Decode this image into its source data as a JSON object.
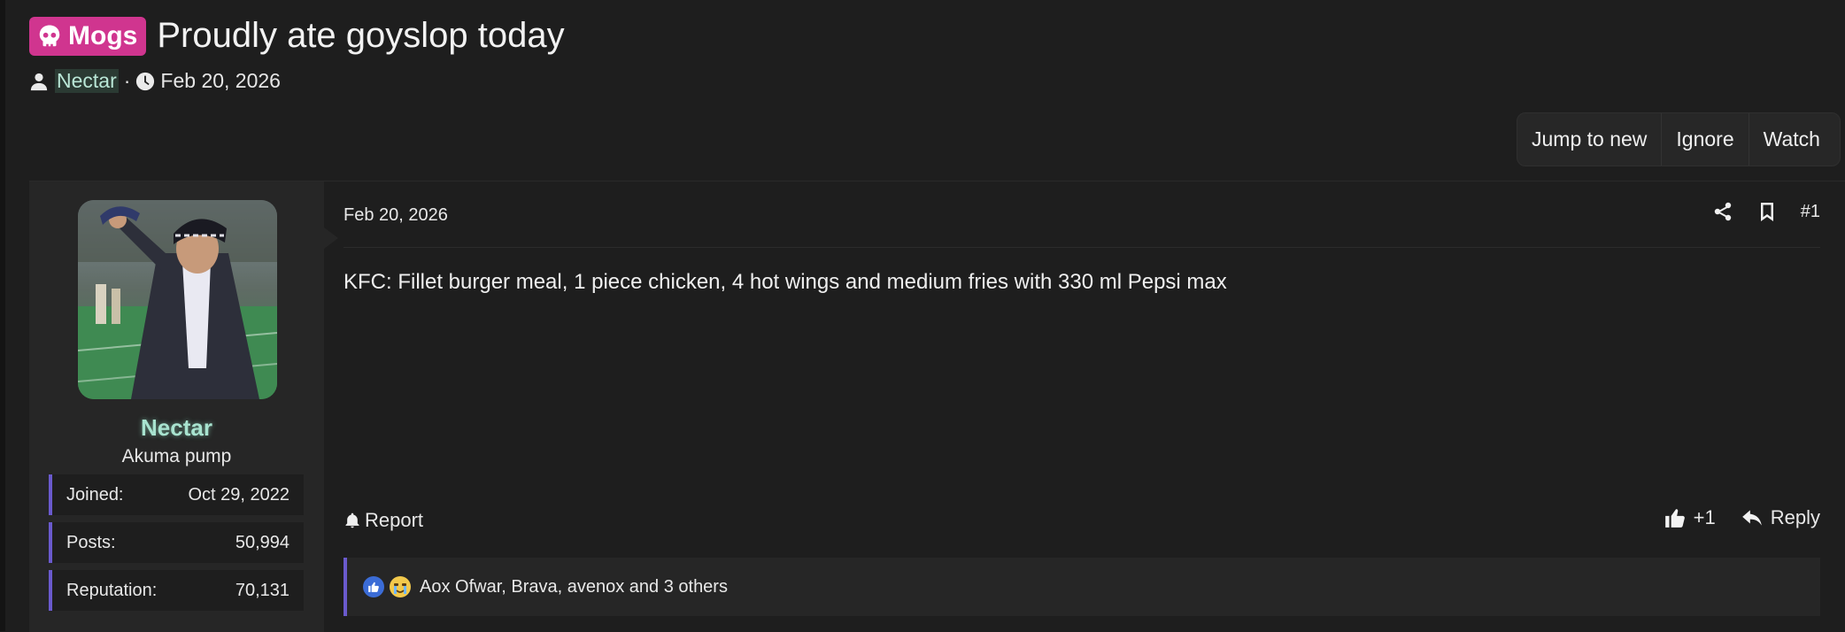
{
  "thread": {
    "prefix": "Mogs",
    "title": "Proudly ate goyslop today",
    "author": "Nectar",
    "separator": "·",
    "date": "Feb 20, 2026"
  },
  "actions": {
    "jump_to_new": "Jump to new",
    "ignore": "Ignore",
    "watch": "Watch"
  },
  "user": {
    "name": "Nectar",
    "title": "Akuma pump",
    "stats": [
      {
        "label": "Joined:",
        "value": "Oct 29, 2022"
      },
      {
        "label": "Posts:",
        "value": "50,994"
      },
      {
        "label": "Reputation:",
        "value": "70,131"
      }
    ]
  },
  "post": {
    "date": "Feb 20, 2026",
    "number": "#1",
    "body": "KFC: Fillet burger meal, 1 piece chicken, 4 hot wings and medium fries with 330 ml Pepsi max",
    "report_label": "Report",
    "like_label": "+1",
    "reply_label": "Reply",
    "reactions_text": "Aox Ofwar, Brava, avenox and 3 others"
  },
  "colors": {
    "prefix_bg": "#d0358f",
    "username": "#a8e3cf",
    "accent": "#6a5acd",
    "background": "#1e1e1e"
  },
  "icons": [
    "skull-icon",
    "user-icon",
    "clock-icon",
    "share-icon",
    "bookmark-icon",
    "bell-icon",
    "thumbs-up-icon",
    "reply-icon",
    "like-reaction-icon",
    "cry-reaction-icon"
  ]
}
